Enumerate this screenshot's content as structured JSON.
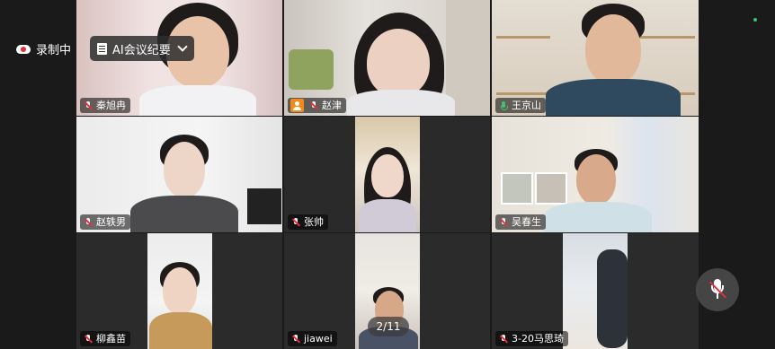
{
  "recording": {
    "label": "录制中",
    "icon": "record-icon"
  },
  "ai_minutes": {
    "label": "AI会议纪要"
  },
  "pager": {
    "label": "2/11"
  },
  "participants": [
    {
      "name": "秦旭冉",
      "mic": "muted"
    },
    {
      "name": "赵津",
      "mic": "muted",
      "host": true
    },
    {
      "name": "王京山",
      "mic": "speaking",
      "active": true
    },
    {
      "name": "赵轶男",
      "mic": "muted"
    },
    {
      "name": "张帅",
      "mic": "muted"
    },
    {
      "name": "吴春生",
      "mic": "muted"
    },
    {
      "name": "柳鑫苗",
      "mic": "muted"
    },
    {
      "name": "jiawei",
      "mic": "muted"
    },
    {
      "name": "3-20马思琦",
      "mic": "muted"
    }
  ],
  "colors": {
    "speaking": "#3ec46d",
    "muted_slash": "#e0303a",
    "host_badge": "#f28a1a"
  }
}
